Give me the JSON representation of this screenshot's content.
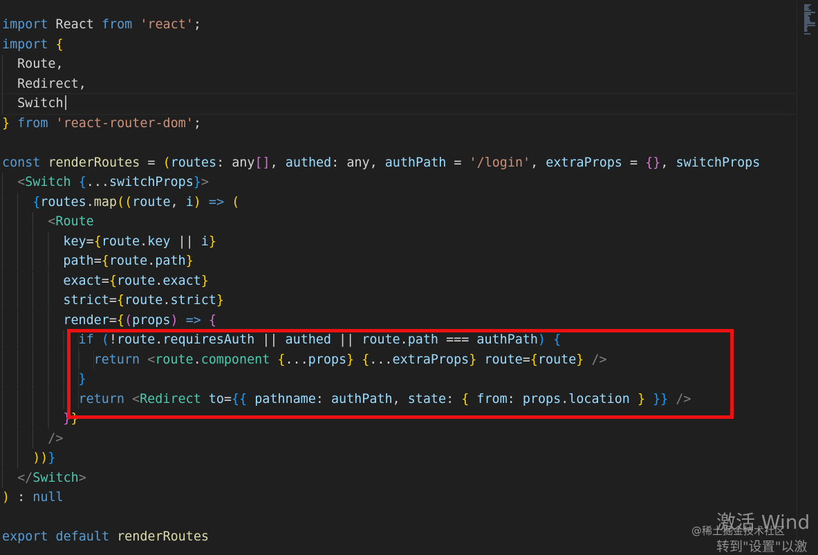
{
  "editor": {
    "language": "typescript-react",
    "colors": {
      "background": "#1f1f1f",
      "keyword": "#569cd6",
      "variable": "#9cdcfe",
      "string": "#ce9178",
      "tag": "#4ec9b0",
      "highlight_box": "#ee1111"
    },
    "cursor_line": 5,
    "highlight_lines": [
      17,
      18,
      19,
      20
    ],
    "lines": [
      [
        [
          "k",
          "import"
        ],
        [
          "t",
          " React "
        ],
        [
          "k",
          "from"
        ],
        [
          "t",
          " "
        ],
        [
          "s",
          "'react'"
        ],
        [
          "t",
          ";"
        ]
      ],
      [
        [
          "k",
          "import"
        ],
        [
          "t",
          " "
        ],
        [
          "b1",
          "{"
        ]
      ],
      [
        [
          "i",
          "  "
        ],
        [
          "t",
          "Route,"
        ]
      ],
      [
        [
          "i",
          "  "
        ],
        [
          "t",
          "Redirect,"
        ]
      ],
      [
        [
          "i",
          "  "
        ],
        [
          "t",
          "Switch"
        ]
      ],
      [
        [
          "b1",
          "}"
        ],
        [
          "t",
          " "
        ],
        [
          "k",
          "from"
        ],
        [
          "t",
          " "
        ],
        [
          "s",
          "'react-router-dom'"
        ],
        [
          "t",
          ";"
        ]
      ],
      [],
      [
        [
          "k",
          "const"
        ],
        [
          "t",
          " "
        ],
        [
          "f",
          "renderRoutes"
        ],
        [
          "t",
          " = "
        ],
        [
          "b1",
          "("
        ],
        [
          "v",
          "routes"
        ],
        [
          "t",
          ": "
        ],
        [
          "t",
          "any"
        ],
        [
          "b2",
          "[]"
        ],
        [
          "t",
          ", "
        ],
        [
          "v",
          "authed"
        ],
        [
          "t",
          ": "
        ],
        [
          "t",
          "any"
        ],
        [
          "t",
          ", "
        ],
        [
          "v",
          "authPath"
        ],
        [
          "t",
          " = "
        ],
        [
          "s",
          "'/login'"
        ],
        [
          "t",
          ", "
        ],
        [
          "v",
          "extraProps"
        ],
        [
          "t",
          " = "
        ],
        [
          "b2",
          "{}"
        ],
        [
          "t",
          ", "
        ],
        [
          "v",
          "switchProps"
        ]
      ],
      [
        [
          "i",
          "  "
        ],
        [
          "p",
          "<"
        ],
        [
          "t",
          "Switch"
        ],
        [
          "t",
          " "
        ],
        [
          "b3",
          "{"
        ],
        [
          "t",
          "..."
        ],
        [
          "v",
          "switchProps"
        ],
        [
          "b3",
          "}"
        ],
        [
          "p",
          ">"
        ]
      ],
      [
        [
          "i",
          "    "
        ],
        [
          "b3",
          "{"
        ],
        [
          "v",
          "routes"
        ],
        [
          "t",
          "."
        ],
        [
          "f",
          "map"
        ],
        [
          "b1",
          "(("
        ],
        [
          "v",
          "route"
        ],
        [
          "t",
          ", "
        ],
        [
          "v",
          "i"
        ],
        [
          "b1",
          ")"
        ],
        [
          "t",
          " "
        ],
        [
          "k",
          "=>"
        ],
        [
          "t",
          " "
        ],
        [
          "b1",
          "("
        ]
      ],
      [
        [
          "i",
          "      "
        ],
        [
          "p",
          "<"
        ],
        [
          "t",
          "Route"
        ]
      ],
      [
        [
          "i",
          "        "
        ],
        [
          "v",
          "key"
        ],
        [
          "t",
          "="
        ],
        [
          "b1",
          "{"
        ],
        [
          "v",
          "route"
        ],
        [
          "t",
          "."
        ],
        [
          "v",
          "key"
        ],
        [
          "t",
          " || "
        ],
        [
          "v",
          "i"
        ],
        [
          "b1",
          "}"
        ]
      ],
      [
        [
          "i",
          "        "
        ],
        [
          "v",
          "path"
        ],
        [
          "t",
          "="
        ],
        [
          "b1",
          "{"
        ],
        [
          "v",
          "route"
        ],
        [
          "t",
          "."
        ],
        [
          "v",
          "path"
        ],
        [
          "b1",
          "}"
        ]
      ],
      [
        [
          "i",
          "        "
        ],
        [
          "v",
          "exact"
        ],
        [
          "t",
          "="
        ],
        [
          "b1",
          "{"
        ],
        [
          "v",
          "route"
        ],
        [
          "t",
          "."
        ],
        [
          "v",
          "exact"
        ],
        [
          "b1",
          "}"
        ]
      ],
      [
        [
          "i",
          "        "
        ],
        [
          "v",
          "strict"
        ],
        [
          "t",
          "="
        ],
        [
          "b1",
          "{"
        ],
        [
          "v",
          "route"
        ],
        [
          "t",
          "."
        ],
        [
          "v",
          "strict"
        ],
        [
          "b1",
          "}"
        ]
      ],
      [
        [
          "i",
          "        "
        ],
        [
          "v",
          "render"
        ],
        [
          "t",
          "="
        ],
        [
          "b1",
          "{"
        ],
        [
          "b2",
          "("
        ],
        [
          "v",
          "props"
        ],
        [
          "b2",
          ")"
        ],
        [
          "t",
          " "
        ],
        [
          "k",
          "=>"
        ],
        [
          "t",
          " "
        ],
        [
          "b2",
          "{"
        ]
      ],
      [
        [
          "i",
          "          "
        ],
        [
          "k",
          "if"
        ],
        [
          "t",
          " "
        ],
        [
          "b3",
          "("
        ],
        [
          "t",
          "!"
        ],
        [
          "v",
          "route"
        ],
        [
          "t",
          "."
        ],
        [
          "v",
          "requiresAuth"
        ],
        [
          "t",
          " || "
        ],
        [
          "v",
          "authed"
        ],
        [
          "t",
          " || "
        ],
        [
          "v",
          "route"
        ],
        [
          "t",
          "."
        ],
        [
          "v",
          "path"
        ],
        [
          "t",
          " === "
        ],
        [
          "v",
          "authPath"
        ],
        [
          "b3",
          ")"
        ],
        [
          "t",
          " "
        ],
        [
          "b3",
          "{"
        ]
      ],
      [
        [
          "i",
          "            "
        ],
        [
          "k",
          "return"
        ],
        [
          "t",
          " "
        ],
        [
          "p",
          "<"
        ],
        [
          "t",
          "route"
        ],
        [
          "t",
          "."
        ],
        [
          "t",
          "component"
        ],
        [
          "t",
          " "
        ],
        [
          "b1",
          "{"
        ],
        [
          "t",
          "..."
        ],
        [
          "v",
          "props"
        ],
        [
          "b1",
          "}"
        ],
        [
          "t",
          " "
        ],
        [
          "b1",
          "{"
        ],
        [
          "t",
          "..."
        ],
        [
          "v",
          "extraProps"
        ],
        [
          "b1",
          "}"
        ],
        [
          "t",
          " "
        ],
        [
          "v",
          "route"
        ],
        [
          "t",
          "="
        ],
        [
          "b1",
          "{"
        ],
        [
          "v",
          "route"
        ],
        [
          "b1",
          "}"
        ],
        [
          "t",
          " "
        ],
        [
          "p",
          "/>"
        ]
      ],
      [
        [
          "i",
          "          "
        ],
        [
          "b3",
          "}"
        ]
      ],
      [
        [
          "i",
          "          "
        ],
        [
          "k",
          "return"
        ],
        [
          "t",
          " "
        ],
        [
          "p",
          "<"
        ],
        [
          "t",
          "Redirect"
        ],
        [
          "t",
          " "
        ],
        [
          "v",
          "to"
        ],
        [
          "t",
          "="
        ],
        [
          "b3",
          "{{"
        ],
        [
          "t",
          " "
        ],
        [
          "v",
          "pathname"
        ],
        [
          "t",
          ": "
        ],
        [
          "v",
          "authPath"
        ],
        [
          "t",
          ", "
        ],
        [
          "v",
          "state"
        ],
        [
          "t",
          ": "
        ],
        [
          "b1",
          "{"
        ],
        [
          "t",
          " "
        ],
        [
          "v",
          "from"
        ],
        [
          "t",
          ": "
        ],
        [
          "v",
          "props"
        ],
        [
          "t",
          "."
        ],
        [
          "v",
          "location"
        ],
        [
          "t",
          " "
        ],
        [
          "b1",
          "}"
        ],
        [
          "t",
          " "
        ],
        [
          "b3",
          "}}"
        ],
        [
          "t",
          " "
        ],
        [
          "p",
          "/>"
        ]
      ],
      [
        [
          "i",
          "        "
        ],
        [
          "b2",
          "}"
        ],
        [
          "b1",
          "}"
        ]
      ],
      [
        [
          "i",
          "      "
        ],
        [
          "p",
          "/>"
        ]
      ],
      [
        [
          "i",
          "    "
        ],
        [
          "b1",
          "))"
        ],
        [
          "b3",
          "}"
        ]
      ],
      [
        [
          "i",
          "  "
        ],
        [
          "p",
          "</"
        ],
        [
          "t",
          "Switch"
        ],
        [
          "p",
          ">"
        ]
      ],
      [
        [
          "b1",
          ")"
        ],
        [
          "t",
          " : "
        ],
        [
          "k",
          "null"
        ]
      ],
      [],
      [
        [
          "k",
          "export"
        ],
        [
          "t",
          " "
        ],
        [
          "k",
          "default"
        ],
        [
          "t",
          " "
        ],
        [
          "f",
          "renderRoutes"
        ]
      ]
    ]
  },
  "watermark": {
    "activate_text": "激活 Wind",
    "site_text": "@稀土掘金技术社区",
    "settings_text": "转到\"设置\"以激"
  }
}
